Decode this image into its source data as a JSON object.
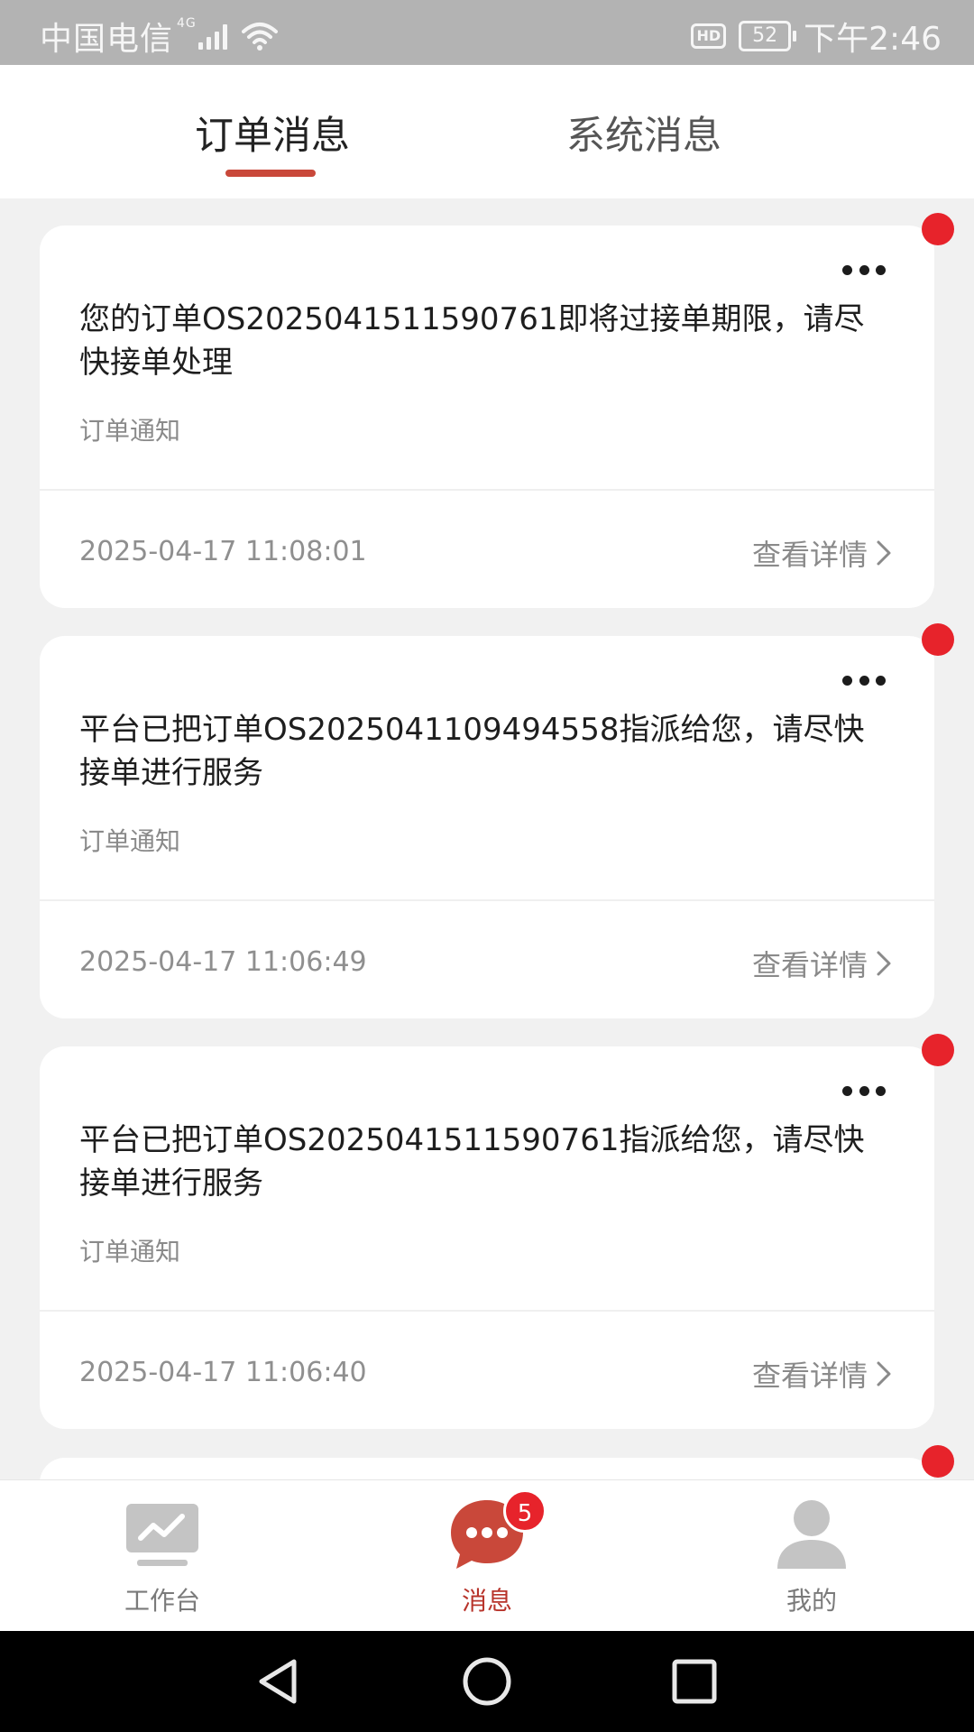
{
  "status_bar": {
    "carrier": "中国电信",
    "network": "4G",
    "hd": "HD",
    "battery": "52",
    "time": "下午2:46"
  },
  "tabs": {
    "order": "订单消息",
    "system": "系统消息",
    "active": "order"
  },
  "messages": [
    {
      "text": "您的订单OS2025041511590761即将过接单期限，请尽快接单处理",
      "category": "订单通知",
      "time": "2025-04-17 11:08:01",
      "detail_label": "查看详情",
      "unread": true
    },
    {
      "text": "平台已把订单OS2025041109494558指派给您，请尽快接单进行服务",
      "category": "订单通知",
      "time": "2025-04-17 11:06:49",
      "detail_label": "查看详情",
      "unread": true
    },
    {
      "text": "平台已把订单OS2025041511590761指派给您，请尽快接单进行服务",
      "category": "订单通知",
      "time": "2025-04-17 11:06:40",
      "detail_label": "查看详情",
      "unread": true
    }
  ],
  "bottom_nav": {
    "workbench": "工作台",
    "messages": "消息",
    "messages_badge": "5",
    "mine": "我的"
  },
  "colors": {
    "accent": "#c9483a",
    "unread_dot": "#e7232b",
    "background": "#f1f1f1"
  },
  "icons": [
    "wifi-icon",
    "signal-icon",
    "more-icon",
    "chevron-right-icon",
    "chart-icon",
    "chat-icon",
    "person-icon",
    "back-icon",
    "home-icon",
    "recents-icon"
  ]
}
